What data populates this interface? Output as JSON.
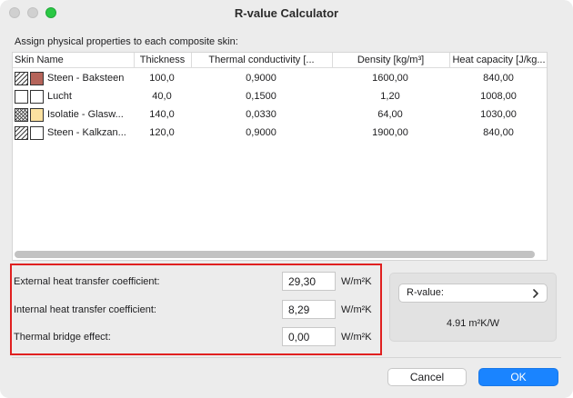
{
  "window": {
    "title": "R-value Calculator"
  },
  "instruction": "Assign physical properties to each composite skin:",
  "table": {
    "columns": [
      "Skin Name",
      "Thickness",
      "Thermal conductivity [...",
      "Density [kg/m³]",
      "Heat capacity [J/kg..."
    ],
    "rows": [
      {
        "name": "Steen - Baksteen",
        "thickness": "100,0",
        "conductivity": "0,9000",
        "density": "1600,00",
        "heat_capacity": "840,00",
        "fill_color": "#b5645a",
        "pattern": "diagonal-hatch"
      },
      {
        "name": "Lucht",
        "thickness": "40,0",
        "conductivity": "0,1500",
        "density": "1,20",
        "heat_capacity": "1008,00",
        "fill_color": "#ffffff",
        "pattern": "empty"
      },
      {
        "name": "Isolatie - Glasw...",
        "thickness": "140,0",
        "conductivity": "0,0330",
        "density": "64,00",
        "heat_capacity": "1030,00",
        "fill_color": "#fbe1a0",
        "pattern": "crosshatch"
      },
      {
        "name": "Steen - Kalkzan...",
        "thickness": "120,0",
        "conductivity": "0,9000",
        "density": "1900,00",
        "heat_capacity": "840,00",
        "fill_color": "#ffffff",
        "pattern": "diagonal-hatch"
      }
    ]
  },
  "params": {
    "external": {
      "label": "External heat transfer coefficient:",
      "value": "29,30",
      "unit": "W/m²K"
    },
    "internal": {
      "label": "Internal heat transfer coefficient:",
      "value": "8,29",
      "unit": "W/m²K"
    },
    "thermal_bridge": {
      "label": "Thermal bridge effect:",
      "value": "0,00",
      "unit": "W/m²K"
    }
  },
  "rvalue": {
    "button_label": "R-value:",
    "chevron_icon": "chevron-right-icon",
    "result": "4.91 m²K/W"
  },
  "buttons": {
    "cancel": "Cancel",
    "ok": "OK"
  },
  "colors": {
    "accent": "#1a84ff",
    "highlight_border": "#e02020"
  }
}
